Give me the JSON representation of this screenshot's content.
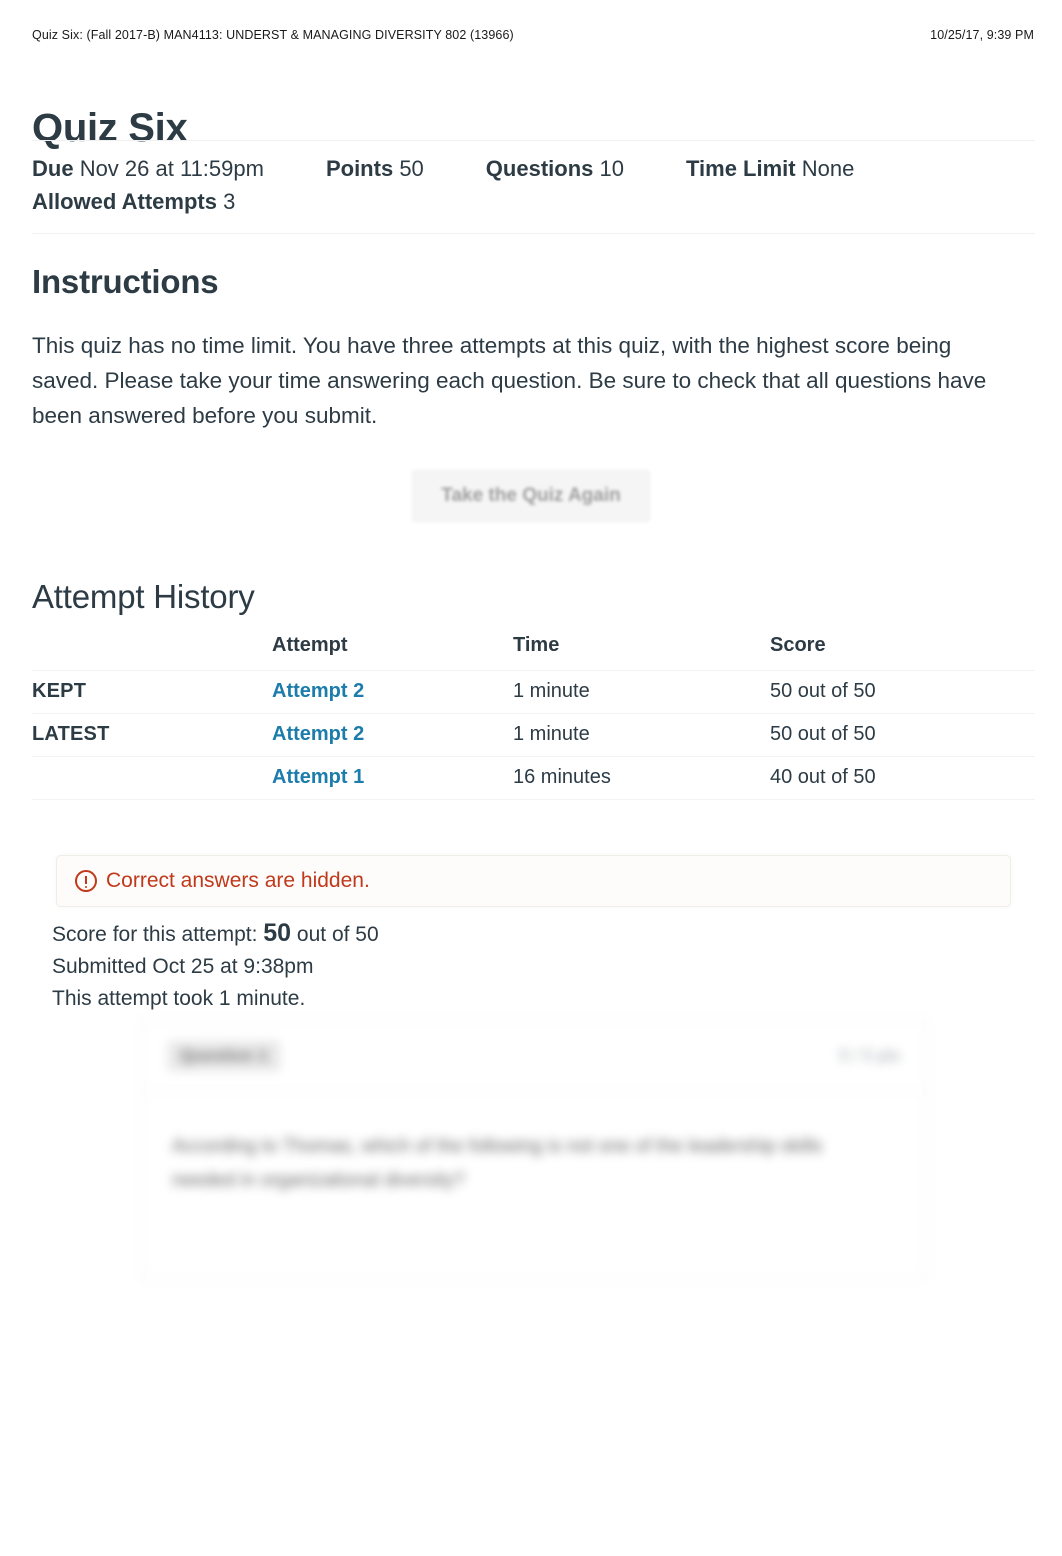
{
  "print_header": {
    "document_title": "Quiz Six: (Fall 2017-B) MAN4113: UNDERST & MANAGING DIVERSITY 802 (13966)",
    "printed_timestamp": "10/25/17, 9:39 PM"
  },
  "quiz": {
    "title": "Quiz Six",
    "meta": [
      {
        "label": "Due",
        "value": "Nov 26 at 11:59pm"
      },
      {
        "label": "Points",
        "value": "50"
      },
      {
        "label": "Questions",
        "value": "10"
      },
      {
        "label": "Time Limit",
        "value": "None"
      }
    ],
    "meta_second_row": [
      {
        "label": "Allowed Attempts",
        "value": "3"
      }
    ]
  },
  "instructions": {
    "heading": "Instructions",
    "body": "This quiz has no time limit.  You have three attempts at this quiz, with the highest score being saved.  Please take your time answering each question.  Be sure to check that all questions have been answered before you submit."
  },
  "actions": {
    "take_again_label": "Take the Quiz Again"
  },
  "attempt_history": {
    "heading": "Attempt History",
    "columns": [
      "",
      "Attempt",
      "Time",
      "Score"
    ],
    "rows": [
      {
        "flag": "KEPT",
        "attempt": "Attempt 2",
        "time": "1 minute",
        "score": "50 out of 50"
      },
      {
        "flag": "LATEST",
        "attempt": "Attempt 2",
        "time": "1 minute",
        "score": "50 out of 50"
      },
      {
        "flag": "",
        "attempt": "Attempt 1",
        "time": "16 minutes",
        "score": "40 out of 50"
      }
    ]
  },
  "alert": {
    "icon": "warning-circle-icon",
    "text": "Correct answers are hidden.",
    "color": "#c0391b"
  },
  "attempt_result": {
    "score_prefix": "Score for this attempt:",
    "score_value": "50",
    "score_suffix": "out of 50",
    "submitted": "Submitted Oct 25 at 9:38pm",
    "duration": "This attempt took 1 minute."
  },
  "question_preview": {
    "label": "Question 1",
    "points": "5 / 5 pts",
    "text": "According to Thomas, which of the following is not one of the leadership skills needed in organizational diversity?"
  },
  "colors": {
    "link_blue": "#1c7cab",
    "text": "#2d3b45",
    "alert_red": "#c0391b",
    "rule": "#f1f1f1"
  }
}
